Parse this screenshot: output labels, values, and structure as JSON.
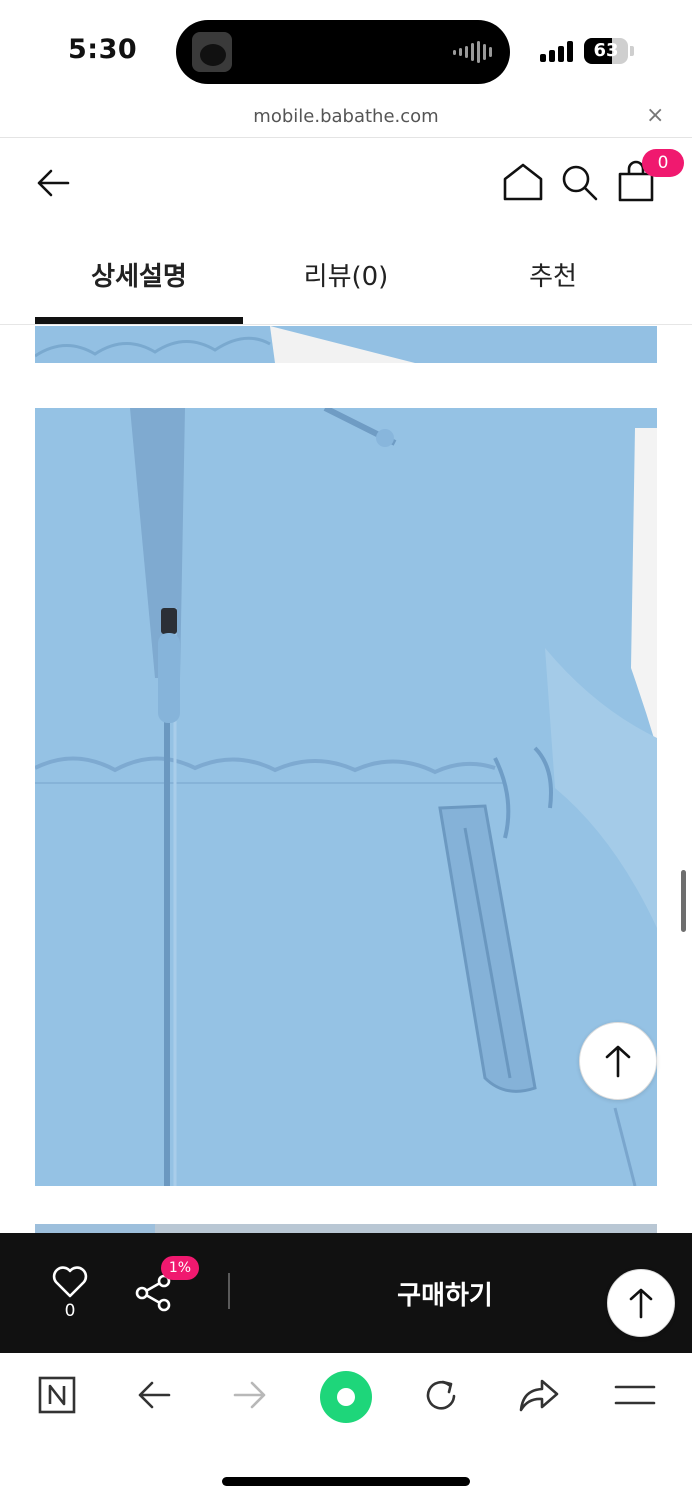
{
  "status_bar": {
    "time": "5:30",
    "battery": "63",
    "battery_level": 0.63
  },
  "browser": {
    "url": "mobile.babathe.com",
    "close_icon": "×"
  },
  "header": {
    "back_icon": "arrow-left-icon",
    "home_icon": "home-icon",
    "search_icon": "search-icon",
    "cart_icon": "shopping-bag-icon",
    "cart_count": "0"
  },
  "tabs": [
    {
      "label": "상세설명",
      "active": true
    },
    {
      "label": "리뷰(0)",
      "active": false
    },
    {
      "label": "추천",
      "active": false
    }
  ],
  "content": {
    "image_color": "#93c0e3"
  },
  "buy_bar": {
    "like_count": "0",
    "share_badge": "1%",
    "buy_label": "구매하기"
  },
  "colors": {
    "accent": "#f0196f",
    "buy_bar_bg": "#111111",
    "toolbar_green": "#1ed67a"
  }
}
